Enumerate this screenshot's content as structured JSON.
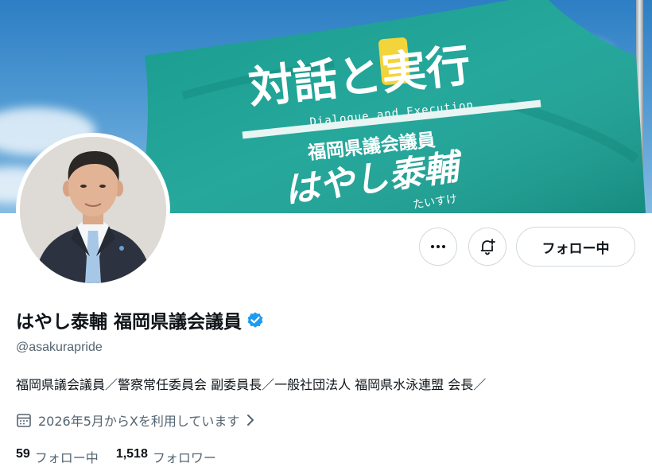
{
  "banner": {
    "flag_slogan": "対話と実行",
    "flag_slogan_en": "Dialogue and Execution",
    "flag_title": "福岡県議会議員",
    "flag_name": "はやし泰輔",
    "flag_name_reading": "たいすけ",
    "flag_color": "#1aa396"
  },
  "actions": {
    "more_icon": "more-icon",
    "notify_icon": "bell-plus-icon",
    "follow_label": "フォロー中"
  },
  "profile": {
    "display_name": "はやし泰輔 福岡県議会議員",
    "verified_color": "#1d9bf0",
    "handle": "@asakurapride",
    "bio": "福岡県議会議員／警察常任委員会 副委員長／一般社団法人 福岡県水泳連盟 会長／",
    "joined": "2026年5月からXを利用しています",
    "following_count": "59",
    "following_label": "フォロー中",
    "followers_count": "1,518",
    "followers_label": "フォロワー"
  }
}
